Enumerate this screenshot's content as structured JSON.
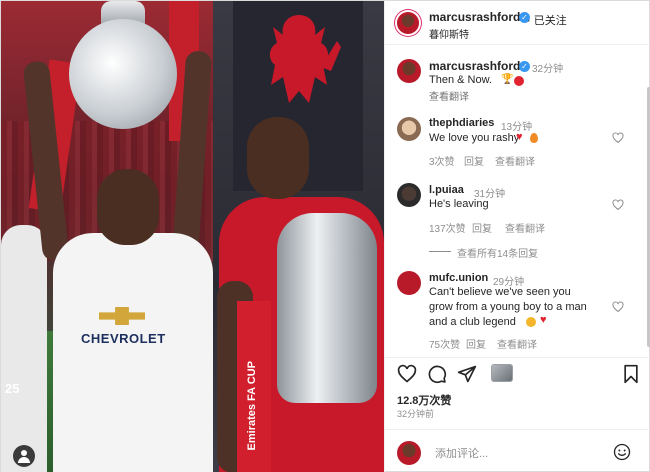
{
  "header": {
    "username": "marcusrashford",
    "follow_state": "· 已关注",
    "subtitle": "暮仰斯特"
  },
  "caption": {
    "username": "marcusrashford",
    "time": "32分钟",
    "text": "Then & Now.",
    "translate": "查看翻译"
  },
  "comments": [
    {
      "username": "thephdiaries",
      "time": "13分钟",
      "text": "We love you rashy",
      "likes": "3次赞",
      "reply": "回复",
      "translate": "查看翻译"
    },
    {
      "username": "l.puiaa",
      "time": "31分钟",
      "text": "He's leaving",
      "likes": "137次赞",
      "reply": "回复",
      "translate": "查看翻译"
    }
  ],
  "view_replies": "查看所有14条回复",
  "comment3": {
    "username": "mufc.union",
    "time": "29分钟",
    "lines": [
      "Can't believe we've seen you",
      "grow from a young boy to a man",
      "and a club legend"
    ],
    "likes": "75次赞",
    "reply": "回复",
    "translate": "查看翻译"
  },
  "post_likes": "12.8万次赞",
  "post_time": "32分钟前",
  "comment_box": {
    "placeholder": "添加评论..."
  },
  "photo": {
    "sponsor_text": "CHEVROLET",
    "ribbon_text": "Emirates FA CUP",
    "shirt_number": "25"
  },
  "colors": {
    "verified": "#3897f0",
    "accent_red": "#c8192a",
    "heart": "#ed4956"
  },
  "icons": [
    "verified-badge-icon",
    "heart-outline-icon",
    "comment-icon",
    "share-icon",
    "save-icon",
    "emoji-icon",
    "trophy-emoji-icon",
    "red-circle-emoji-icon",
    "tag-user-icon"
  ]
}
